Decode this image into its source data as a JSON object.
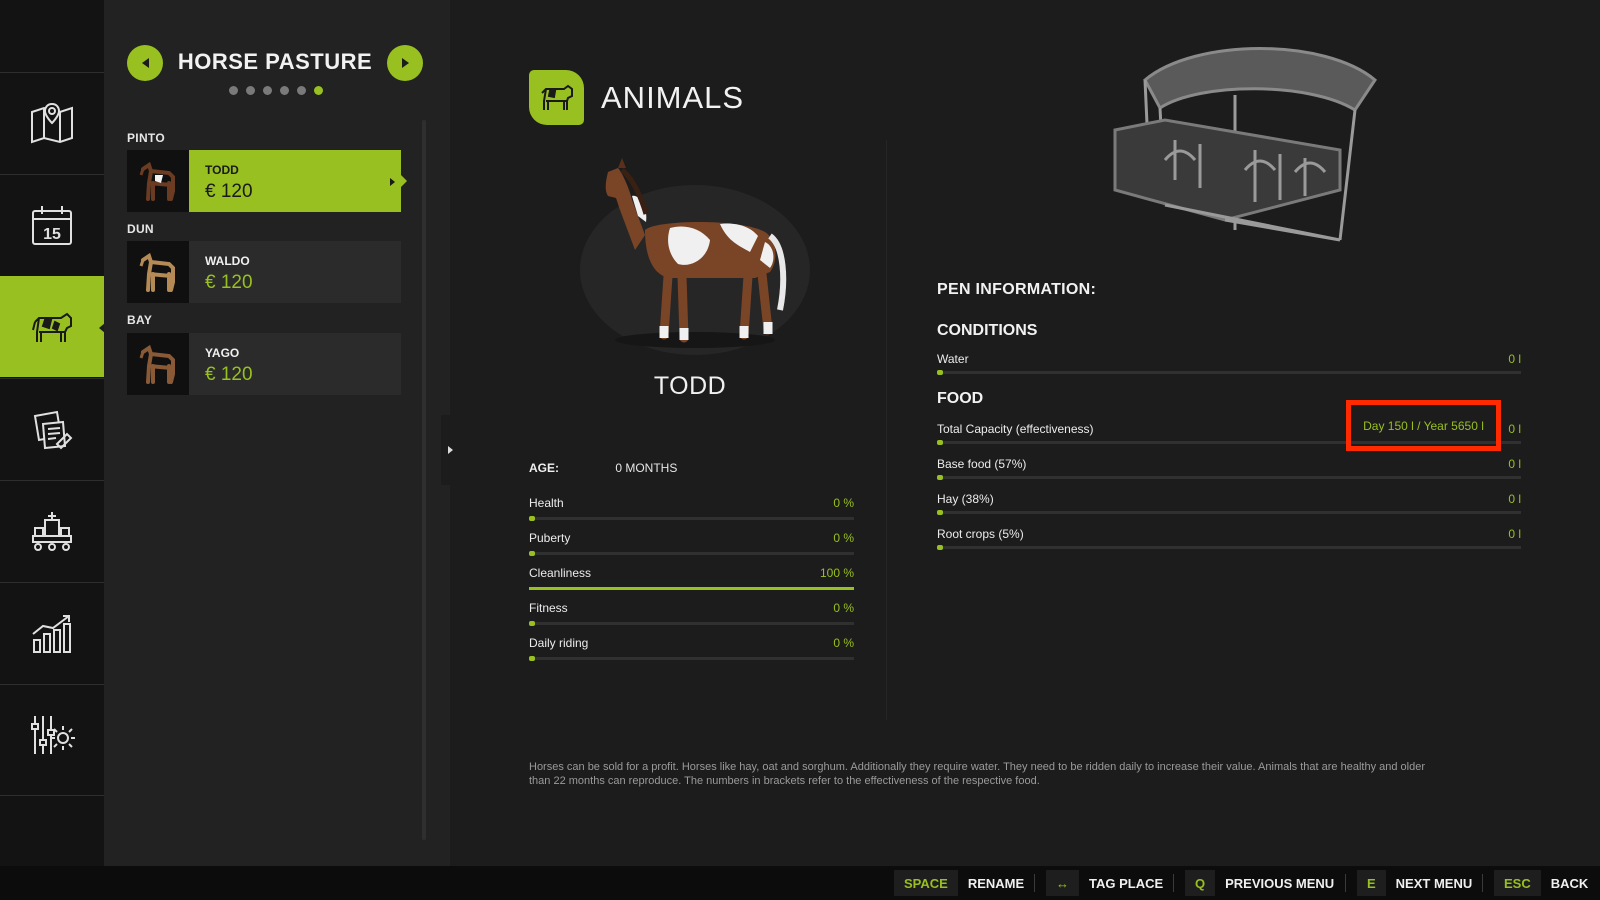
{
  "colors": {
    "accent": "#97c020",
    "highlight_border": "#ff2a00",
    "background": "#1c1c1c",
    "panel": "#222222"
  },
  "rail": {
    "items": [
      {
        "icon": "map-icon",
        "active": false
      },
      {
        "icon": "calendar-icon",
        "date": "15",
        "active": false
      },
      {
        "icon": "animals-cow-icon",
        "active": true
      },
      {
        "icon": "contracts-icon",
        "active": false
      },
      {
        "icon": "production-icon",
        "active": false
      },
      {
        "icon": "statistics-icon",
        "active": false
      },
      {
        "icon": "settings-icon",
        "active": false
      }
    ]
  },
  "pasture": {
    "title": "HORSE PASTURE",
    "page_count": 6,
    "current_page": 6,
    "groups": [
      {
        "label": "PINTO",
        "animal": {
          "name": "TODD",
          "price": "€ 120",
          "selected": true
        }
      },
      {
        "label": "DUN",
        "animal": {
          "name": "WALDO",
          "price": "€ 120",
          "selected": false
        }
      },
      {
        "label": "BAY",
        "animal": {
          "name": "YAGO",
          "price": "€ 120",
          "selected": false
        }
      }
    ]
  },
  "animals": {
    "title": "ANIMALS",
    "selected_name": "TODD",
    "age_label": "AGE:",
    "age_value": "0 MONTHS",
    "stats": [
      {
        "label": "Health",
        "value": "0 %",
        "fraction": 0
      },
      {
        "label": "Puberty",
        "value": "0 %",
        "fraction": 0
      },
      {
        "label": "Cleanliness",
        "value": "100 %",
        "fraction": 1
      },
      {
        "label": "Fitness",
        "value": "0 %",
        "fraction": 0
      },
      {
        "label": "Daily riding",
        "value": "0 %",
        "fraction": 0
      }
    ]
  },
  "pen": {
    "title": "PEN INFORMATION:",
    "conditions_title": "CONDITIONS",
    "conditions": [
      {
        "label": "Water",
        "value": "0 l"
      }
    ],
    "food_title": "FOOD",
    "capacity": {
      "label": "Total Capacity (effectiveness)",
      "value": "0 l",
      "detail": "Day 150 l / Year 5650 l"
    },
    "food": [
      {
        "label": "Base food (57%)",
        "value": "0 l"
      },
      {
        "label": "Hay (38%)",
        "value": "0 l"
      },
      {
        "label": "Root crops (5%)",
        "value": "0 l"
      }
    ]
  },
  "description": "Horses can be sold for a profit. Horses like hay, oat and sorghum. Additionally they require water. They need to be ridden daily to increase their value. Animals that are healthy and older than 22 months can reproduce. The numbers in brackets refer to the effectiveness of the respective food.",
  "hints": [
    {
      "key": "SPACE",
      "action": "RENAME"
    },
    {
      "key": "↔",
      "action": "TAG PLACE"
    },
    {
      "key": "Q",
      "action": "PREVIOUS MENU"
    },
    {
      "key": "E",
      "action": "NEXT MENU"
    },
    {
      "key": "ESC",
      "action": "BACK"
    }
  ]
}
